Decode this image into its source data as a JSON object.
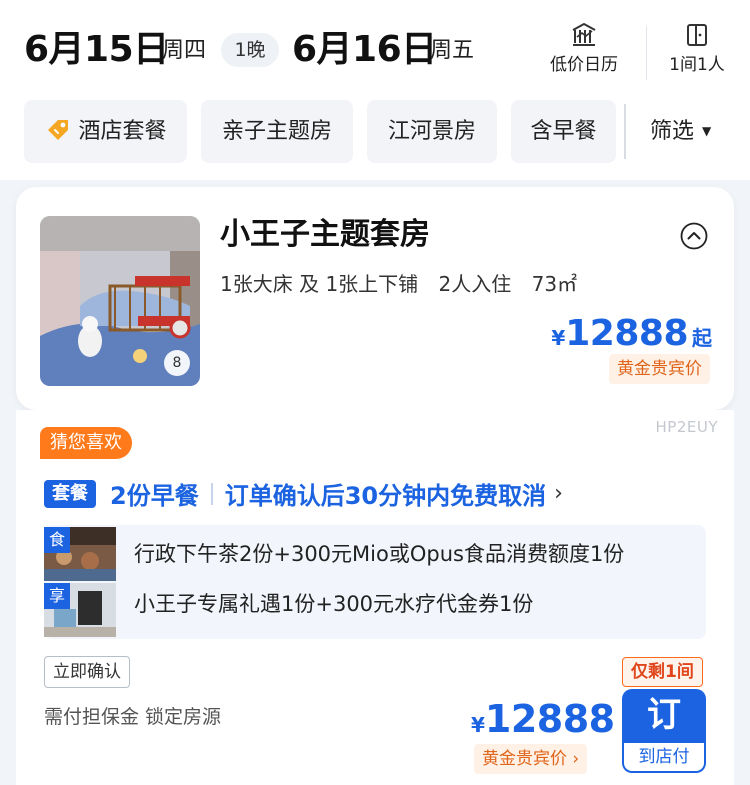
{
  "dates": {
    "checkin_date": "6月15日",
    "checkin_weekday": "周四",
    "nights": "1晚",
    "checkout_date": "6月16日",
    "checkout_weekday": "周五"
  },
  "header_actions": {
    "price_calendar": "低价日历",
    "rooms_guests": "1间1人"
  },
  "filters": {
    "chips": [
      "酒店套餐",
      "亲子主题房",
      "江河景房",
      "含早餐"
    ],
    "filter_label": "筛选"
  },
  "room": {
    "title": "小王子主题套房",
    "beds": "1张大床 及 1张上下铺",
    "occupancy": "2人入住",
    "area": "73㎡",
    "photo_count": "8",
    "price_currency": "¥",
    "price": "12888",
    "price_suffix": "起",
    "price_tag": "黄金贵宾价"
  },
  "package": {
    "watermark": "HP2EUY",
    "recommend_tag": "猜您喜欢",
    "badge": "套餐",
    "breakfast": "2份早餐",
    "cancellation": "订单确认后30分钟内免费取消",
    "arrow": "›",
    "perks": [
      {
        "label": "食",
        "text": "行政下午茶2份+300元Mio或Opus食品消费额度1份"
      },
      {
        "label": "享",
        "text": "小王子专属礼遇1份+300元水疗代金券1份"
      }
    ],
    "confirm_tag": "立即确认",
    "guarantee": "需付担保金 锁定房源",
    "remaining": "仅剩1间",
    "price_currency": "¥",
    "price": "12888",
    "price_tag": "黄金贵宾价 ›",
    "book_label": "订",
    "book_sub": "到店付"
  },
  "colors": {
    "brand_blue": "#1b63e0",
    "vip_orange": "#e0651b",
    "recommend_orange": "#ff7a1a"
  }
}
